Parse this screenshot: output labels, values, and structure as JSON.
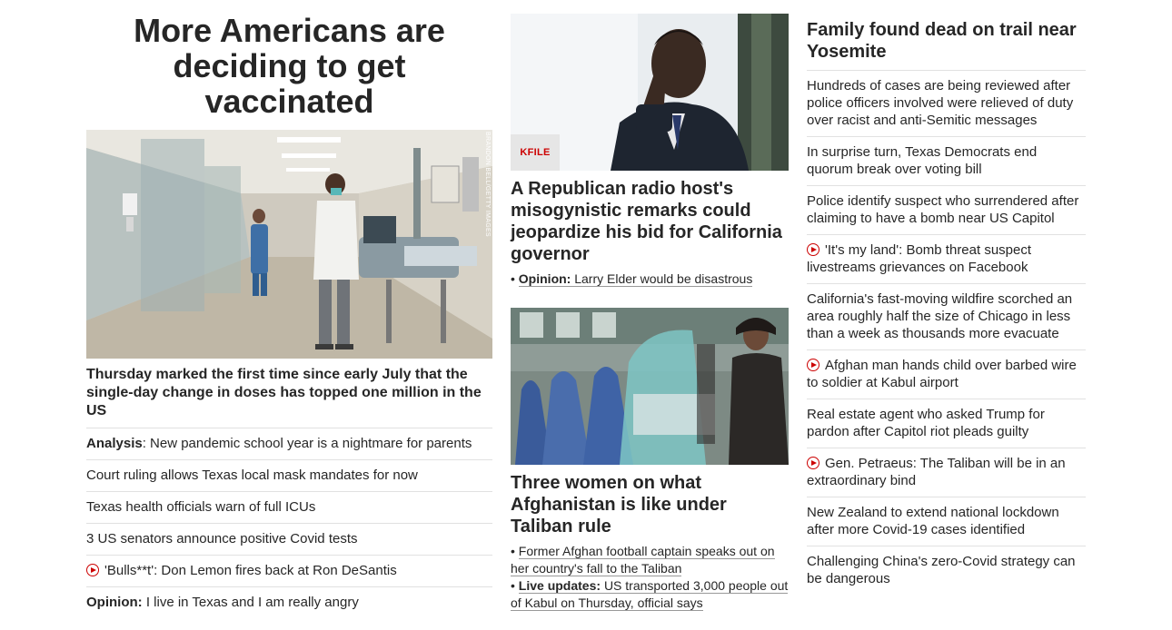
{
  "left": {
    "headline": "More Americans are deciding to get vaccinated",
    "photo_credit": "BRANDON BELL/GETTY IMAGES",
    "caption": "Thursday marked the first time since early July that the single-day change in doses has topped one million in the US",
    "items": [
      {
        "prefix": "Analysis",
        "text": ": New pandemic school year is a nightmare for parents",
        "video": false
      },
      {
        "prefix": "",
        "text": "Court ruling allows Texas local mask mandates for now",
        "video": false
      },
      {
        "prefix": "",
        "text": "Texas health officials warn of full ICUs",
        "video": false
      },
      {
        "prefix": "",
        "text": "3 US senators announce positive Covid tests",
        "video": false
      },
      {
        "prefix": "",
        "text": "'Bulls**t': Don Lemon fires back at Ron DeSantis",
        "video": true
      },
      {
        "prefix": "Opinion:",
        "text": " I live in Texas and I am really angry",
        "video": false
      }
    ]
  },
  "middle": {
    "story1": {
      "badge": "KFILE",
      "headline": "A Republican radio host's misogynistic remarks could jeopardize his bid for California governor",
      "sub_prefix": "Opinion:",
      "sub_text": "Larry Elder would be disastrous"
    },
    "story2": {
      "headline": "Three women on what Afghanistan is like under Taliban rule",
      "sub1_text": "Former Afghan football captain speaks out on her country's fall to the Taliban",
      "sub2_prefix": "Live updates:",
      "sub2_text": "US transported 3,000 people out of Kabul on Thursday, official says"
    }
  },
  "right": {
    "headline": "Family found dead on trail near Yosemite",
    "items": [
      {
        "text": "Hundreds of cases are being reviewed after police officers involved were relieved of duty over racist and anti-Semitic messages",
        "video": false
      },
      {
        "text": "In surprise turn, Texas Democrats end quorum break over voting bill",
        "video": false
      },
      {
        "text": "Police identify suspect who surrendered after claiming to have a bomb near US Capitol",
        "video": false
      },
      {
        "text": "'It's my land': Bomb threat suspect livestreams grievances on Facebook",
        "video": true
      },
      {
        "text": "California's fast-moving wildfire scorched an area roughly half the size of Chicago in less than a week as thousands more evacuate",
        "video": false
      },
      {
        "text": "Afghan man hands child over barbed wire to soldier at Kabul airport",
        "video": true
      },
      {
        "text": "Real estate agent who asked Trump for pardon after Capitol riot pleads guilty",
        "video": false
      },
      {
        "text": "Gen. Petraeus: The Taliban will be in an extraordinary bind",
        "video": true
      },
      {
        "text": "New Zealand to extend national lockdown after more Covid-19 cases identified",
        "video": false
      },
      {
        "text": "Challenging China's zero-Covid strategy can be dangerous",
        "video": false
      }
    ]
  },
  "colors": {
    "accent": "#cc0000",
    "text": "#262626",
    "divider": "#e1e1e1"
  },
  "icons": {
    "video": "play-circle-icon"
  }
}
